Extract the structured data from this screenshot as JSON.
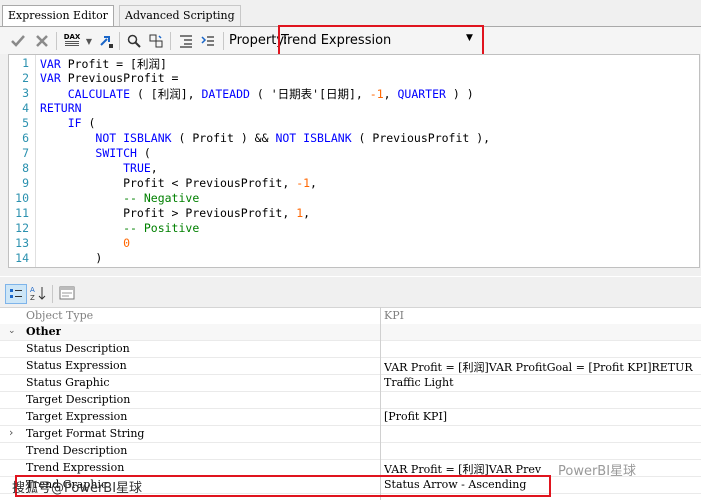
{
  "tabs": [
    {
      "label": "Expression Editor",
      "active": true
    },
    {
      "label": "Advanced Scripting",
      "active": false
    }
  ],
  "toolbar": {
    "accept_icon": "check-icon",
    "cancel_icon": "close-icon",
    "dax_label": "DAX",
    "property_label": "Property:",
    "property_value": "Trend Expression"
  },
  "editor": {
    "line_numbers": [
      "1",
      "2",
      "3",
      "4",
      "5",
      "6",
      "7",
      "8",
      "9",
      "10",
      "11",
      "12",
      "13",
      "14"
    ],
    "lines": [
      {
        "parts": [
          {
            "t": "VAR",
            "c": "kw"
          },
          {
            "t": " Profit = [利润]",
            "c": ""
          }
        ]
      },
      {
        "parts": [
          {
            "t": "VAR",
            "c": "kw"
          },
          {
            "t": " PreviousProfit =",
            "c": ""
          }
        ]
      },
      {
        "parts": [
          {
            "t": "    ",
            "c": ""
          },
          {
            "t": "CALCULATE",
            "c": "kw"
          },
          {
            "t": " ( [利润], ",
            "c": ""
          },
          {
            "t": "DATEADD",
            "c": "kw"
          },
          {
            "t": " ( '日期表'[日期], ",
            "c": ""
          },
          {
            "t": "-1",
            "c": "num"
          },
          {
            "t": ", ",
            "c": ""
          },
          {
            "t": "QUARTER",
            "c": "kw"
          },
          {
            "t": " ) )",
            "c": ""
          }
        ]
      },
      {
        "parts": [
          {
            "t": "RETURN",
            "c": "kw"
          }
        ]
      },
      {
        "parts": [
          {
            "t": "    ",
            "c": ""
          },
          {
            "t": "IF",
            "c": "kw"
          },
          {
            "t": " (",
            "c": ""
          }
        ]
      },
      {
        "parts": [
          {
            "t": "        ",
            "c": ""
          },
          {
            "t": "NOT",
            "c": "kw"
          },
          {
            "t": " ",
            "c": ""
          },
          {
            "t": "ISBLANK",
            "c": "kw"
          },
          {
            "t": " ( Profit ) && ",
            "c": ""
          },
          {
            "t": "NOT",
            "c": "kw"
          },
          {
            "t": " ",
            "c": ""
          },
          {
            "t": "ISBLANK",
            "c": "kw"
          },
          {
            "t": " ( PreviousProfit ),",
            "c": ""
          }
        ]
      },
      {
        "parts": [
          {
            "t": "        ",
            "c": ""
          },
          {
            "t": "SWITCH",
            "c": "kw"
          },
          {
            "t": " (",
            "c": ""
          }
        ]
      },
      {
        "parts": [
          {
            "t": "            ",
            "c": ""
          },
          {
            "t": "TRUE",
            "c": "kw"
          },
          {
            "t": ",",
            "c": ""
          }
        ]
      },
      {
        "parts": [
          {
            "t": "            Profit < PreviousProfit, ",
            "c": ""
          },
          {
            "t": "-1",
            "c": "num"
          },
          {
            "t": ",",
            "c": ""
          }
        ]
      },
      {
        "parts": [
          {
            "t": "            ",
            "c": ""
          },
          {
            "t": "-- Negative",
            "c": "cmt"
          }
        ]
      },
      {
        "parts": [
          {
            "t": "            Profit > PreviousProfit, ",
            "c": ""
          },
          {
            "t": "1",
            "c": "num"
          },
          {
            "t": ",",
            "c": ""
          }
        ]
      },
      {
        "parts": [
          {
            "t": "            ",
            "c": ""
          },
          {
            "t": "-- Positive",
            "c": "cmt"
          }
        ]
      },
      {
        "parts": [
          {
            "t": "            ",
            "c": ""
          },
          {
            "t": "0",
            "c": "num"
          }
        ]
      },
      {
        "parts": [
          {
            "t": "        )",
            "c": ""
          }
        ]
      }
    ]
  },
  "properties": {
    "header": {
      "name": "Object Type",
      "value": "KPI"
    },
    "category": "Other",
    "rows": [
      {
        "name": "Status Description",
        "value": ""
      },
      {
        "name": "Status Expression",
        "value": "VAR Profit = [利润]VAR ProfitGoal = [Profit KPI]RETUR"
      },
      {
        "name": "Status Graphic",
        "value": "Traffic Light"
      },
      {
        "name": "Target Description",
        "value": ""
      },
      {
        "name": "Target Expression",
        "value": "[Profit KPI]"
      },
      {
        "name": "Target Format String",
        "value": ""
      },
      {
        "name": "Trend Description",
        "value": ""
      },
      {
        "name": "Trend Expression",
        "value": "VAR Profit = [利润]VAR Prev"
      },
      {
        "name": "Trend Graphic",
        "value": "Status Arrow - Ascending"
      }
    ]
  },
  "watermarks": {
    "left": "搜狐号@PowerBI星球",
    "right": "PowerBI星球"
  },
  "colors": {
    "highlight_red": "#e0141e",
    "keyword": "#0000ff",
    "number": "#ff6600",
    "comment": "#008000",
    "line_number": "#2b91af"
  }
}
